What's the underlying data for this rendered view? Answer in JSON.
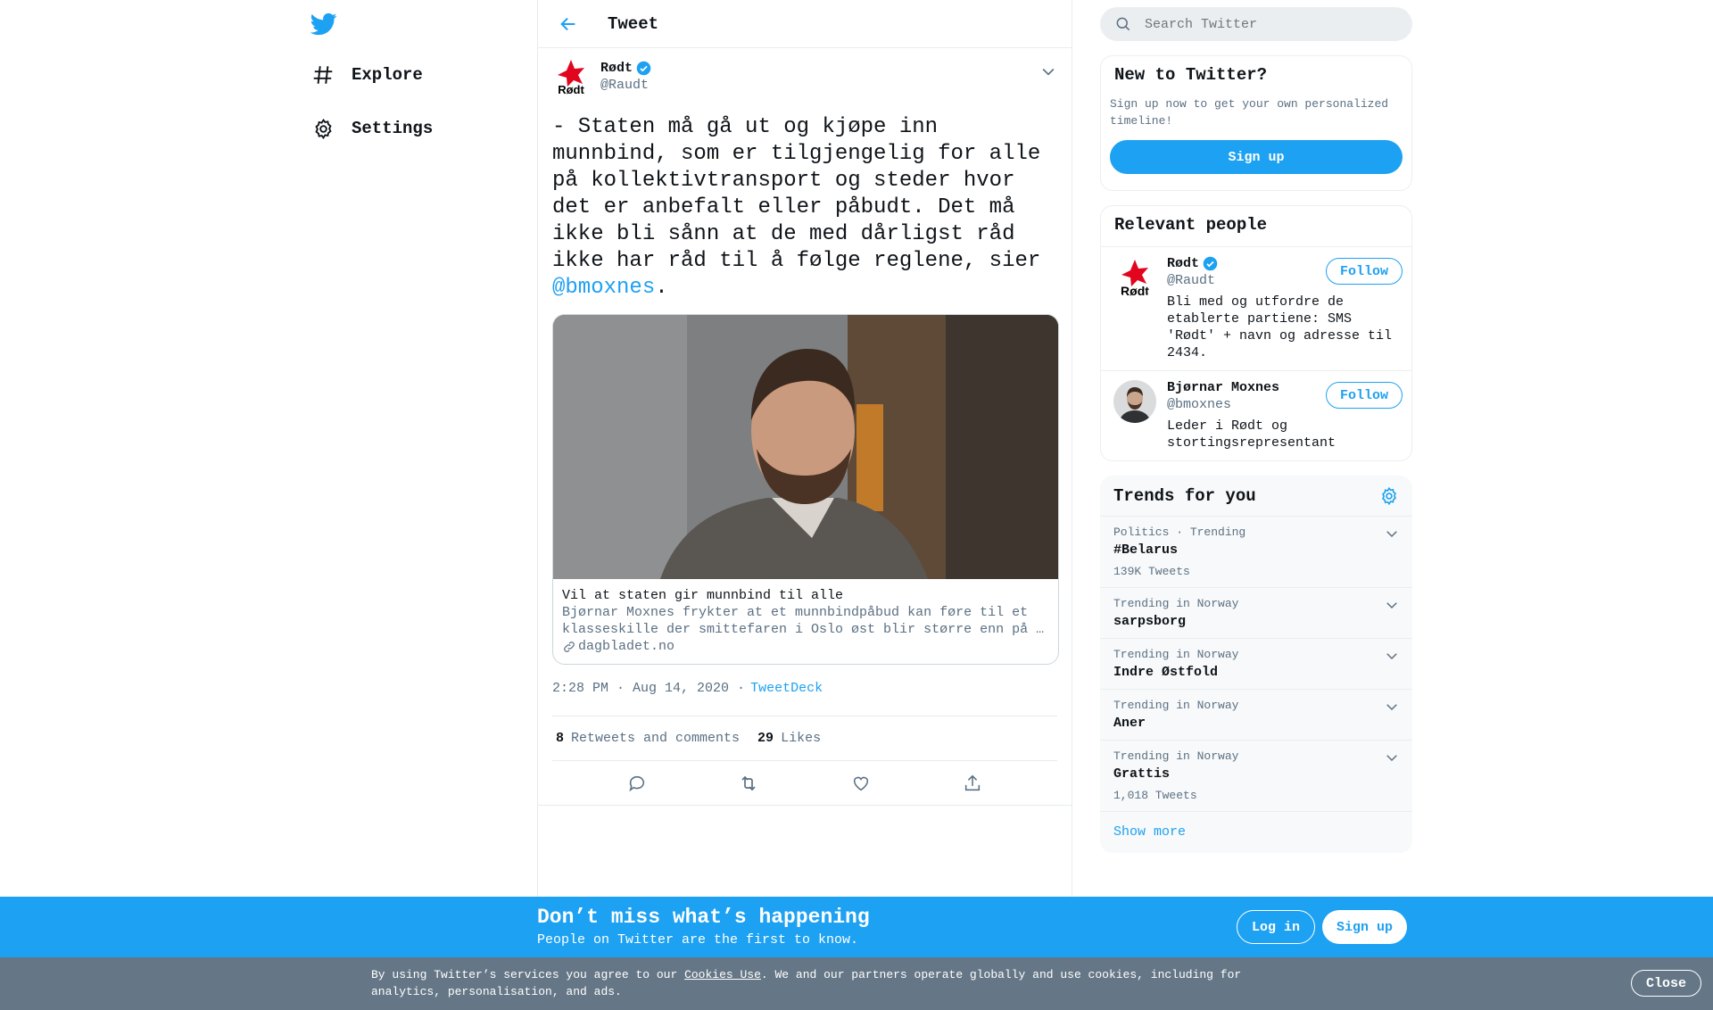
{
  "nav": {
    "explore_label": "Explore",
    "settings_label": "Settings"
  },
  "header": {
    "title": "Tweet"
  },
  "tweet": {
    "author_name": "Rødt",
    "author_handle": "@Raudt",
    "avatar_text": "Rødt",
    "text_before": "- Staten må gå ut og kjøpe inn munnbind, som er tilgjengelig for alle på kollektivtransport og steder hvor det er anbefalt eller påbudt. Det må ikke bli sånn at de med dårligst råd ikke har råd til å følge reglene, sier ",
    "mention": "@bmoxnes",
    "text_after": ".",
    "card": {
      "title": "Vil at staten gir munnbind til alle",
      "description_line1": "Bjørnar Moxnes frykter at et munnbindpåbud kan føre til et",
      "description_line2": "klasseskille der smittefaren i Oslo øst blir større enn på …",
      "domain": "dagbladet.no"
    },
    "timestamp": "2:28 PM · Aug 14, 2020",
    "source": "TweetDeck",
    "retweets_count": "8",
    "retweets_label": "Retweets and comments",
    "likes_count": "29",
    "likes_label": "Likes"
  },
  "search": {
    "placeholder": "Search Twitter"
  },
  "new_to_twitter": {
    "title": "New to Twitter?",
    "description": "Sign up now to get your own personalized timeline!",
    "button": "Sign up"
  },
  "relevant_people": {
    "title": "Relevant people",
    "people": [
      {
        "name": "Rødt",
        "handle": "@Raudt",
        "bio": "Bli med og utfordre de etablerte partiene: SMS 'Rødt' + navn og adresse til 2434.",
        "follow": "Follow"
      },
      {
        "name": "Bjørnar Moxnes",
        "handle": "@bmoxnes",
        "bio": "Leder i Rødt og stortingsrepresentant",
        "follow": "Follow"
      }
    ]
  },
  "trends": {
    "title": "Trends for you",
    "items": [
      {
        "context": "Politics · Trending",
        "name": "#Belarus",
        "count": "139K Tweets"
      },
      {
        "context": "Trending in Norway",
        "name": "sarpsborg",
        "count": ""
      },
      {
        "context": "Trending in Norway",
        "name": "Indre Østfold",
        "count": ""
      },
      {
        "context": "Trending in Norway",
        "name": "Aner",
        "count": ""
      },
      {
        "context": "Trending in Norway",
        "name": "Grattis",
        "count": "1,018 Tweets"
      }
    ],
    "show_more": "Show more"
  },
  "banner": {
    "title": "Don’t miss what’s happening",
    "subtitle": "People on Twitter are the first to know.",
    "login": "Log in",
    "signup": "Sign up"
  },
  "cookie": {
    "text_before": "By using Twitter’s services you agree to our ",
    "link": "Cookies Use",
    "text_after": ". We and our partners operate globally and use cookies, including for analytics, personalisation, and ads.",
    "close": "Close"
  },
  "colors": {
    "accent": "#1da1f2",
    "secondary_text": "#5b7083",
    "rodt_red": "#e1051e"
  }
}
